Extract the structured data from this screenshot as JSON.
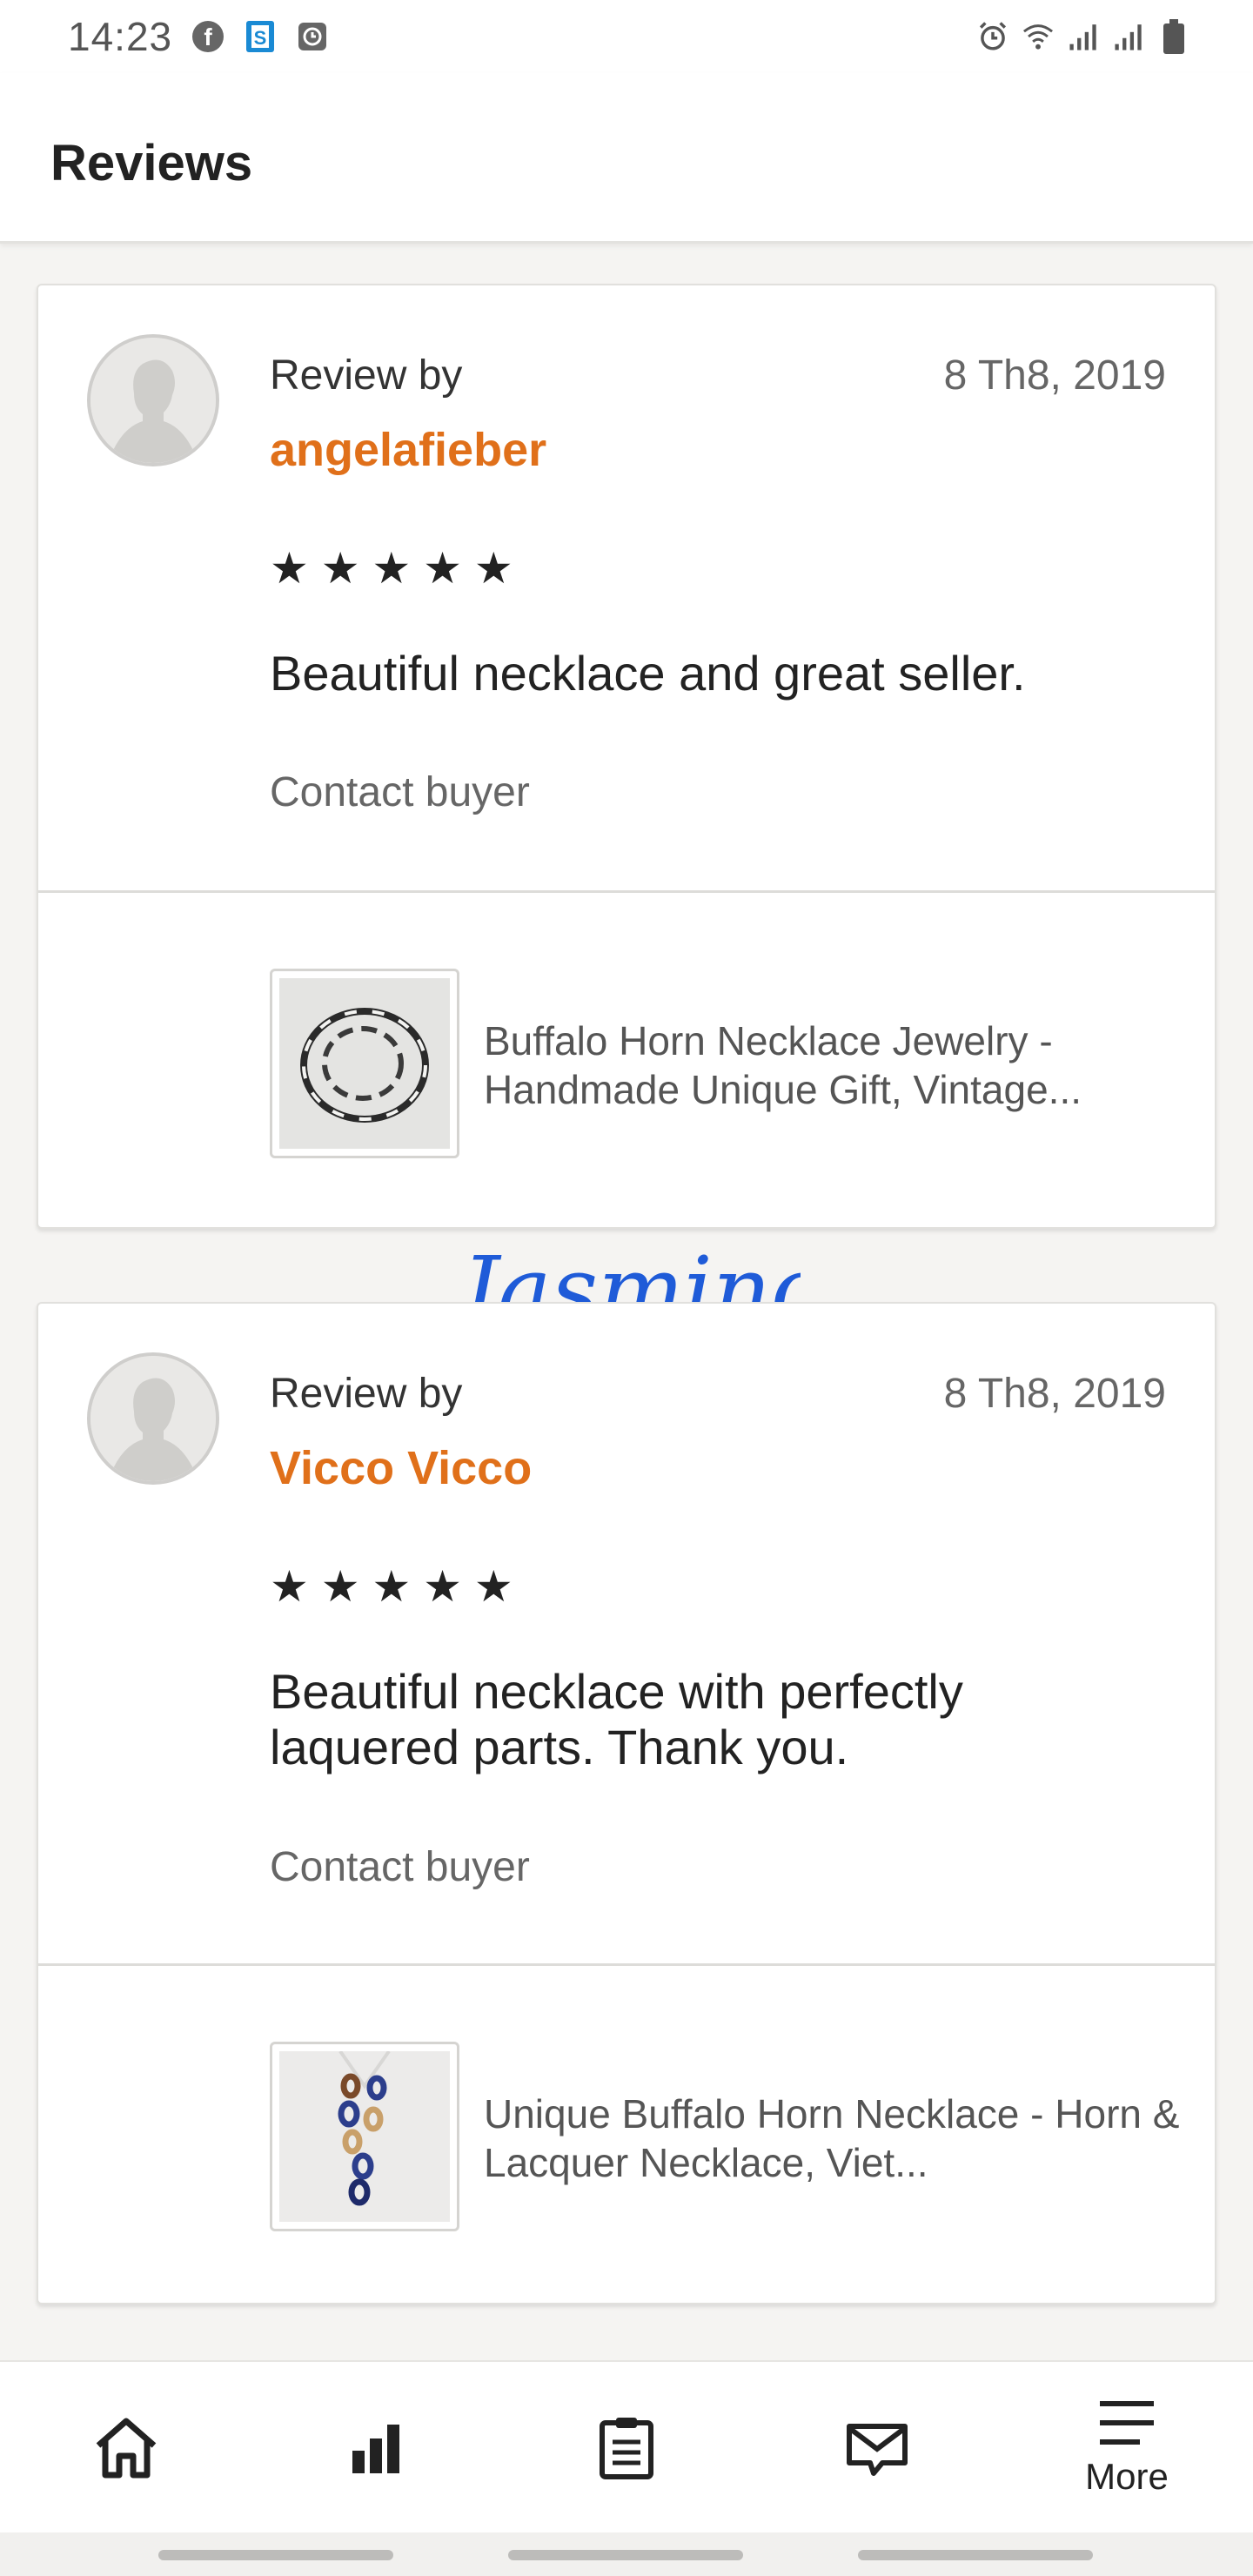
{
  "status_bar": {
    "time": "14:23",
    "left_icons": [
      "facebook-icon",
      "skype-icon",
      "clock-app-icon"
    ],
    "right_icons": [
      "alarm-icon",
      "wifi-icon",
      "signal-icon",
      "signal-icon",
      "battery-icon"
    ]
  },
  "header": {
    "title": "Reviews"
  },
  "reviews": [
    {
      "review_by_label": "Review by",
      "reviewer": "angelafieber",
      "date": "8 Th8, 2019",
      "stars": "★ ★ ★ ★ ★",
      "rating": 5,
      "text": "Beautiful necklace and great seller.",
      "contact_label": "Contact buyer",
      "listing_title": "Buffalo Horn Necklace Jewelry - Handmade Unique Gift, Vintage..."
    },
    {
      "review_by_label": "Review by",
      "reviewer": "Vicco Vicco",
      "date": "8 Th8, 2019",
      "stars": "★ ★ ★ ★ ★",
      "rating": 5,
      "text": "Beautiful necklace with perfectly laquered parts. Thank you.",
      "contact_label": "Contact buyer",
      "listing_title": "Unique Buffalo Horn Necklace - Horn & Lacquer Necklace, Viet..."
    }
  ],
  "signature": "Jasmino",
  "bottom_nav": {
    "items": [
      {
        "icon": "home-icon"
      },
      {
        "icon": "stats-icon"
      },
      {
        "icon": "orders-icon"
      },
      {
        "icon": "messages-icon"
      },
      {
        "icon": "menu-icon",
        "label": "More"
      }
    ]
  },
  "colors": {
    "accent": "#e0701a",
    "background": "#f5f4f2",
    "signature": "#1f5bd8"
  }
}
